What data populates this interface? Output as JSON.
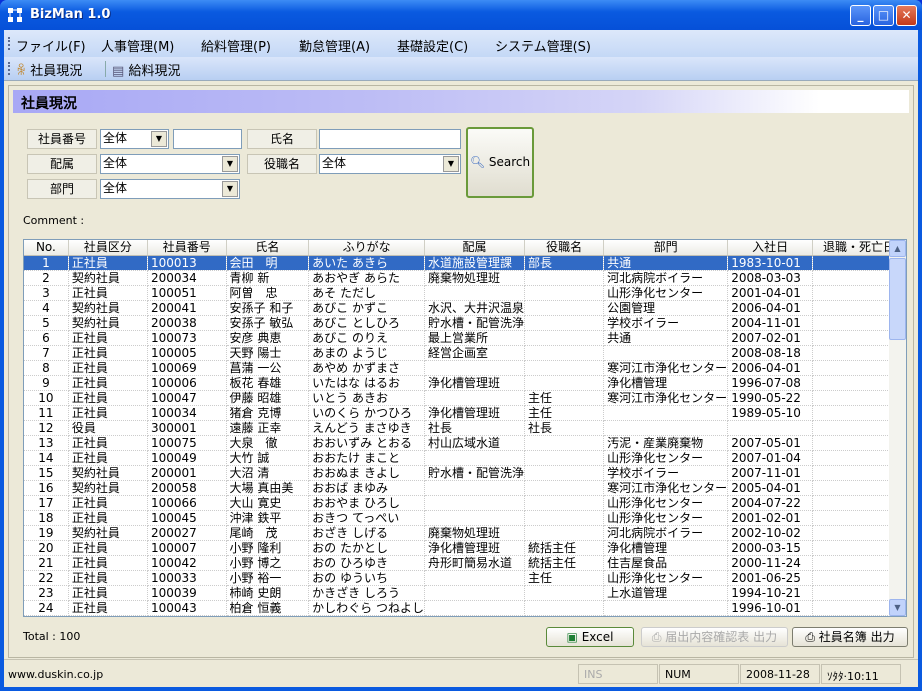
{
  "window": {
    "title": "BizMan 1.0",
    "minimize": "_",
    "maximize": "□",
    "close": "✕"
  },
  "menu": [
    "ファイル(F)",
    "人事管理(M)",
    "給料管理(P)",
    "勤怠管理(A)",
    "基礎設定(C)",
    "システム管理(S)"
  ],
  "toolbar": {
    "employees": "社員現況",
    "salary": "給料現況"
  },
  "section_title": "社員現況",
  "filters": {
    "emp_no_label": "社員番号",
    "emp_no_op": "全体",
    "emp_no_value": "",
    "name_label": "氏名",
    "name_value": "",
    "dept_label": "配属",
    "dept_value": "全体",
    "position_label": "役職名",
    "position_value": "全体",
    "division_label": "部門",
    "division_value": "全体",
    "search_label": "Search"
  },
  "comment_label": "Comment :",
  "table": {
    "columns": [
      "No.",
      "社員区分",
      "社員番号",
      "氏名",
      "ふりがな",
      "配属",
      "役職名",
      "部門",
      "入社日",
      "退職・死亡日"
    ],
    "selected_row": 1,
    "rows": [
      [
        "1",
        "正社員",
        "100013",
        "会田　明",
        "あいた あきら",
        "水道施設管理課",
        "部長",
        "共通",
        "1983-10-01",
        ""
      ],
      [
        "2",
        "契約社員",
        "200034",
        "青柳 新",
        "あおやぎ あらた",
        "廃棄物処理班",
        "",
        "河北病院ボイラー",
        "2008-03-03",
        ""
      ],
      [
        "3",
        "正社員",
        "100051",
        "阿曽　忠",
        "あそ ただし",
        "",
        "",
        "山形浄化センター",
        "2001-04-01",
        ""
      ],
      [
        "4",
        "契約社員",
        "200041",
        "安孫子 和子",
        "あびこ かずこ",
        "水沢、大井沢温泉",
        "",
        "公園管理",
        "2006-04-01",
        ""
      ],
      [
        "5",
        "契約社員",
        "200038",
        "安孫子 敏弘",
        "あびこ としひろ",
        "貯水槽・配管洗浄",
        "",
        "学校ボイラー",
        "2004-11-01",
        ""
      ],
      [
        "6",
        "正社員",
        "100073",
        "安彦 典恵",
        "あびこ のりえ",
        "最上営業所",
        "",
        "共通",
        "2007-02-01",
        ""
      ],
      [
        "7",
        "正社員",
        "100005",
        "天野 陽士",
        "あまの ようじ",
        "経営企画室",
        "",
        "",
        "2008-08-18",
        ""
      ],
      [
        "8",
        "正社員",
        "100069",
        "菖蒲 一公",
        "あやめ かずまさ",
        "",
        "",
        "寒河江市浄化センター",
        "2006-04-01",
        ""
      ],
      [
        "9",
        "正社員",
        "100006",
        "板花 春雄",
        "いたはな はるお",
        "浄化槽管理班",
        "",
        "浄化槽管理",
        "1996-07-08",
        ""
      ],
      [
        "10",
        "正社員",
        "100047",
        "伊藤 昭雄",
        "いとう あきお",
        "",
        "主任",
        "寒河江市浄化センター",
        "1990-05-22",
        ""
      ],
      [
        "11",
        "正社員",
        "100034",
        "猪倉 克博",
        "いのくら かつひろ",
        "浄化槽管理班",
        "主任",
        "",
        "1989-05-10",
        ""
      ],
      [
        "12",
        "役員",
        "300001",
        "遠藤 正幸",
        "えんどう まさゆき",
        "社長",
        "社長",
        "",
        "",
        ""
      ],
      [
        "13",
        "正社員",
        "100075",
        "大泉　徹",
        "おおいずみ とおる",
        "村山広域水道",
        "",
        "汚泥・産業廃棄物",
        "2007-05-01",
        ""
      ],
      [
        "14",
        "正社員",
        "100049",
        "大竹 誠",
        "おおたけ まこと",
        "",
        "",
        "山形浄化センター",
        "2007-01-04",
        ""
      ],
      [
        "15",
        "契約社員",
        "200001",
        "大沼 清",
        "おおぬま きよし",
        "貯水槽・配管洗浄",
        "",
        "学校ボイラー",
        "2007-11-01",
        ""
      ],
      [
        "16",
        "契約社員",
        "200058",
        "大場 真由美",
        "おおば まゆみ",
        "",
        "",
        "寒河江市浄化センター",
        "2005-04-01",
        ""
      ],
      [
        "17",
        "正社員",
        "100066",
        "大山 寛史",
        "おおやま ひろし",
        "",
        "",
        "山形浄化センター",
        "2004-07-22",
        ""
      ],
      [
        "18",
        "正社員",
        "100045",
        "沖津 鉄平",
        "おきつ てっぺい",
        "",
        "",
        "山形浄化センター",
        "2001-02-01",
        ""
      ],
      [
        "19",
        "契約社員",
        "200027",
        "尾崎　茂",
        "おざき しげる",
        "廃棄物処理班",
        "",
        "河北病院ボイラー",
        "2002-10-02",
        ""
      ],
      [
        "20",
        "正社員",
        "100007",
        "小野 隆利",
        "おの たかとし",
        "浄化槽管理班",
        "統括主任",
        "浄化槽管理",
        "2000-03-15",
        ""
      ],
      [
        "21",
        "正社員",
        "100042",
        "小野 博之",
        "おの ひろゆき",
        "舟形町簡易水道",
        "統括主任",
        "住吉屋食品",
        "2000-11-24",
        ""
      ],
      [
        "22",
        "正社員",
        "100033",
        "小野 裕一",
        "おの ゆういち",
        "",
        "主任",
        "山形浄化センター",
        "2001-06-25",
        ""
      ],
      [
        "23",
        "正社員",
        "100039",
        "柿崎 史朗",
        "かきざき しろう",
        "",
        "",
        "上水道管理",
        "1994-10-21",
        ""
      ],
      [
        "24",
        "正社員",
        "100043",
        "柏倉 恒義",
        "かしわぐら つねよし",
        "",
        "",
        "",
        "1996-10-01",
        ""
      ]
    ]
  },
  "footer": {
    "total": "Total : 100",
    "excel": "Excel",
    "confirm_print": "届出内容確認表 出力",
    "roster_print": "社員名簿 出力"
  },
  "statusbar": {
    "site": "www.duskin.co.jp",
    "ins": "INS",
    "num": "NUM",
    "date": "2008-11-28",
    "time": "ｿﾀﾀ·10:11"
  }
}
